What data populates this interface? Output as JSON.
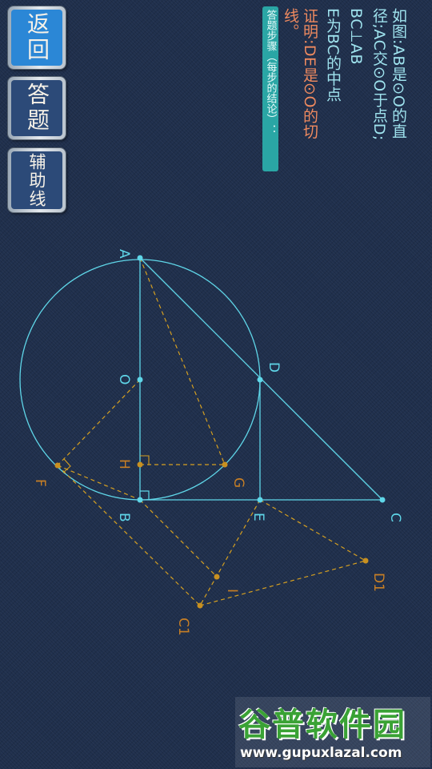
{
  "buttons": {
    "back": "返回",
    "answer": "答题",
    "aux_lines": "辅助线"
  },
  "answer_steps_label": "答题步骤（每步的结论）：",
  "problem": {
    "line1": "如图:AB是⊙O的直",
    "line2": "径;AC交⊙O于点D;",
    "line3": "BC⊥AB",
    "line4": "E为BC的中点",
    "line5": "证明:DE是⊙O的切",
    "line6": "线。"
  },
  "points": {
    "A": "A",
    "O": "O",
    "D": "D",
    "H": "H",
    "G": "G",
    "B": "B",
    "E": "E",
    "C": "C",
    "F": "F",
    "I": "I",
    "C1": "C1",
    "D1": "D1"
  },
  "colors": {
    "figure": "#5fd6e8",
    "auxiliary": "#d6a020",
    "aux_label": "#c87f25",
    "problem_text": "#9fe3ee",
    "prove_text": "#ef8a5f",
    "back_button": "#2b87d6",
    "other_buttons": "#2c4a78"
  },
  "watermark": {
    "title": "谷普软件园",
    "url": "www.gupuxlazal.com"
  }
}
